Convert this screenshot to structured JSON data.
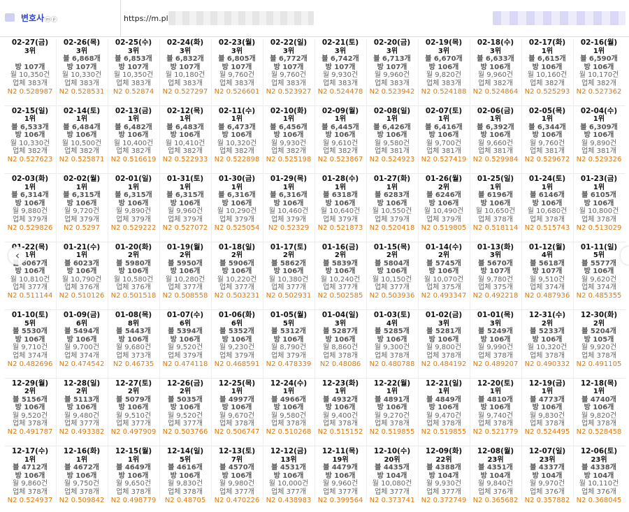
{
  "header": {
    "brand_label": "변호사",
    "url": "https://m.place"
  },
  "rows": [
    [
      {
        "date": "02-27(금)",
        "rank": "3위",
        "rev": "",
        "vis": "방 107개",
        "mon": "월 10,350건",
        "biz": "업체 383개",
        "n2": "N2 0.528987"
      },
      {
        "date": "02-26(목)",
        "rank": "3위",
        "rev": "블 6,868개",
        "vis": "방 107개",
        "mon": "월 10,330건",
        "biz": "업체 383개",
        "n2": "N2 0.528531"
      },
      {
        "date": "02-25(수)",
        "rank": "3위",
        "rev": "블 6,853개",
        "vis": "방 107개",
        "mon": "월 10,350건",
        "biz": "업체 383개",
        "n2": "N2 0.52874"
      },
      {
        "date": "02-24(화)",
        "rank": "3위",
        "rev": "블 6,832개",
        "vis": "방 107개",
        "mon": "월 10,180건",
        "biz": "업체 383개",
        "n2": "N2 0.527297"
      },
      {
        "date": "02-23(월)",
        "rank": "3위",
        "rev": "블 6,805개",
        "vis": "방 107개",
        "mon": "월 9,760건",
        "biz": "업체 383개",
        "n2": "N2 0.526601"
      },
      {
        "date": "02-22(일)",
        "rank": "3위",
        "rev": "블 6,772개",
        "vis": "방 107개",
        "mon": "월 9,760건",
        "biz": "업체 383개",
        "n2": "N2 0.523927"
      },
      {
        "date": "02-21(토)",
        "rank": "3위",
        "rev": "블 6,742개",
        "vis": "방 107개",
        "mon": "월 9,930건",
        "biz": "업체 383개",
        "n2": "N2 0.524478"
      },
      {
        "date": "02-20(금)",
        "rank": "3위",
        "rev": "블 6,713개",
        "vis": "방 107개",
        "mon": "월 9,960건",
        "biz": "업체 383개",
        "n2": "N2 0.523942"
      },
      {
        "date": "02-19(목)",
        "rank": "3위",
        "rev": "블 6,670개",
        "vis": "방 106개",
        "mon": "월 9,820건",
        "biz": "업체 383개",
        "n2": "N2 0.524188"
      },
      {
        "date": "02-18(수)",
        "rank": "3위",
        "rev": "블 6,633개",
        "vis": "방 106개",
        "mon": "월 9,960건",
        "biz": "업체 382개",
        "n2": "N2 0.524864"
      },
      {
        "date": "02-17(화)",
        "rank": "1위",
        "rev": "블 6,615개",
        "vis": "방 106개",
        "mon": "월 10,160건",
        "biz": "업체 382개",
        "n2": "N2 0.525293"
      },
      {
        "date": "02-16(월)",
        "rank": "1위",
        "rev": "블 6,590개",
        "vis": "방 106개",
        "mon": "월 10,170건",
        "biz": "업체 382개",
        "n2": "N2 0.527362"
      }
    ],
    [
      {
        "date": "02-15(일)",
        "rank": "1위",
        "rev": "블 6,533개",
        "vis": "방 106개",
        "mon": "월 10,330건",
        "biz": "업체 382개",
        "n2": "N2 0.527623"
      },
      {
        "date": "02-14(토)",
        "rank": "1위",
        "rev": "블 6,484개",
        "vis": "방 106개",
        "mon": "월 10,500건",
        "biz": "업체 382개",
        "n2": "N2 0.525871"
      },
      {
        "date": "02-13(금)",
        "rank": "1위",
        "rev": "블 6,482개",
        "vis": "방 106개",
        "mon": "월 10,400건",
        "biz": "업체 382개",
        "n2": "N2 0.516619"
      },
      {
        "date": "02-12(목)",
        "rank": "1위",
        "rev": "블 6,483개",
        "vis": "방 106개",
        "mon": "월 10,410건",
        "biz": "업체 382개",
        "n2": "N2 0.522933"
      },
      {
        "date": "02-11(수)",
        "rank": "1위",
        "rev": "블 6,473개",
        "vis": "방 106개",
        "mon": "월 10,320건",
        "biz": "업체 382개",
        "n2": "N2 0.522898"
      },
      {
        "date": "02-10(화)",
        "rank": "1위",
        "rev": "블 6,456개",
        "vis": "방 106개",
        "mon": "월 9,930건",
        "biz": "업체 382개",
        "n2": "N2 0.525198"
      },
      {
        "date": "02-09(월)",
        "rank": "1위",
        "rev": "블 6,445개",
        "vis": "방 106개",
        "mon": "월 9,610건",
        "biz": "업체 382개",
        "n2": "N2 0.523867"
      },
      {
        "date": "02-08(일)",
        "rank": "1위",
        "rev": "블 6,426개",
        "vis": "방 106개",
        "mon": "월 9,580건",
        "biz": "업체 381개",
        "n2": "N2 0.524923"
      },
      {
        "date": "02-07(토)",
        "rank": "1위",
        "rev": "블 6,416개",
        "vis": "방 106개",
        "mon": "월 9,700건",
        "biz": "업체 381개",
        "n2": "N2 0.527419"
      },
      {
        "date": "02-06(금)",
        "rank": "1위",
        "rev": "블 6,392개",
        "vis": "방 106개",
        "mon": "월 9,660건",
        "biz": "업체 381개",
        "n2": "N2 0.529984"
      },
      {
        "date": "02-05(목)",
        "rank": "1위",
        "rev": "블 6,344개",
        "vis": "방 106개",
        "mon": "월 9,760건",
        "biz": "업체 381개",
        "n2": "N2 0.529672"
      },
      {
        "date": "02-04(수)",
        "rank": "1위",
        "rev": "블 6,309개",
        "vis": "방 106개",
        "mon": "월 9,890건",
        "biz": "업체 381개",
        "n2": "N2 0.529326"
      }
    ],
    [
      {
        "date": "02-03(화)",
        "rank": "1위",
        "rev": "블 6,314개",
        "vis": "방 106개",
        "mon": "월 9,880건",
        "biz": "업체 379개",
        "n2": "N2 0.529826"
      },
      {
        "date": "02-02(월)",
        "rank": "1위",
        "rev": "블 6,315개",
        "vis": "방 106개",
        "mon": "월 9,720건",
        "biz": "업체 379개",
        "n2": "N2 0.5297"
      },
      {
        "date": "02-01(일)",
        "rank": "1위",
        "rev": "블 6,315개",
        "vis": "방 106개",
        "mon": "월 9,890건",
        "biz": "업체 379개",
        "n2": "N2 0.529222"
      },
      {
        "date": "01-31(토)",
        "rank": "1위",
        "rev": "블 6,315개",
        "vis": "방 106개",
        "mon": "월 9,960건",
        "biz": "업체 379개",
        "n2": "N2 0.527072"
      },
      {
        "date": "01-30(금)",
        "rank": "1위",
        "rev": "블 6,316개",
        "vis": "방 106개",
        "mon": "월 10,290건",
        "biz": "업체 379개",
        "n2": "N2 0.525054"
      },
      {
        "date": "01-29(목)",
        "rank": "1위",
        "rev": "블 6,316개",
        "vis": "방 106개",
        "mon": "월 10,460건",
        "biz": "업체 379개",
        "n2": "N2 0.52329"
      },
      {
        "date": "01-28(수)",
        "rank": "1위",
        "rev": "블 6318개",
        "vis": "방 106개",
        "mon": "월 10,640건",
        "biz": "업체 379개",
        "n2": "N2 0.521873"
      },
      {
        "date": "01-27(화)",
        "rank": "1위",
        "rev": "블 6283개",
        "vis": "방 106개",
        "mon": "월 10,550건",
        "biz": "업체 379개",
        "n2": "N2 0.520418"
      },
      {
        "date": "01-26(월)",
        "rank": "2위",
        "rev": "블 6246개",
        "vis": "방 106개",
        "mon": "월 10,490건",
        "biz": "업체 379개",
        "n2": "N2 0.519805"
      },
      {
        "date": "01-25(일)",
        "rank": "1위",
        "rev": "블 6196개",
        "vis": "방 106개",
        "mon": "월 10,650건",
        "biz": "업체 378개",
        "n2": "N2 0.518114"
      },
      {
        "date": "01-24(토)",
        "rank": "1위",
        "rev": "블 6146개",
        "vis": "방 106개",
        "mon": "월 10,680건",
        "biz": "업체 378개",
        "n2": "N2 0.515743"
      },
      {
        "date": "01-23(금)",
        "rank": "1위",
        "rev": "블 6105개",
        "vis": "방 106개",
        "mon": "월 10,800건",
        "biz": "업체 378개",
        "n2": "N2 0.513029"
      }
    ],
    [
      {
        "date": "01-22(목)",
        "rank": "1위",
        "rev": "블 6067개",
        "vis": "방 106개",
        "mon": "월 10,810건",
        "biz": "업체 377개",
        "n2": "N2 0.511144"
      },
      {
        "date": "01-21(수)",
        "rank": "1위",
        "rev": "블 6023개",
        "vis": "방 106개",
        "mon": "월 10,790건",
        "biz": "업체 376개",
        "n2": "N2 0.510126"
      },
      {
        "date": "01-20(화)",
        "rank": "2위",
        "rev": "블 5980개",
        "vis": "방 106개",
        "mon": "월 10,580건",
        "biz": "업체 376개",
        "n2": "N2 0.501518"
      },
      {
        "date": "01-19(월)",
        "rank": "2위",
        "rev": "블 5950개",
        "vis": "방 106개",
        "mon": "월 10,280건",
        "biz": "업체 377개",
        "n2": "N2 0.508558"
      },
      {
        "date": "01-18(일)",
        "rank": "2위",
        "rev": "블 5906개",
        "vis": "방 106개",
        "mon": "월 10,220건",
        "biz": "업체 377개",
        "n2": "N2 0.503231"
      },
      {
        "date": "01-17(토)",
        "rank": "2위",
        "rev": "블 5862개",
        "vis": "방 106개",
        "mon": "월 10,380건",
        "biz": "업체 377개",
        "n2": "N2 0.502931"
      },
      {
        "date": "01-16(금)",
        "rank": "2위",
        "rev": "블 5839개",
        "vis": "방 106개",
        "mon": "월 10,240건",
        "biz": "업체 377개",
        "n2": "N2 0.502585"
      },
      {
        "date": "01-15(목)",
        "rank": "2위",
        "rev": "블 5804개",
        "vis": "방 106개",
        "mon": "월 10,150건",
        "biz": "업체 377개",
        "n2": "N2 0.503936"
      },
      {
        "date": "01-14(수)",
        "rank": "2위",
        "rev": "블 5745개",
        "vis": "방 106개",
        "mon": "월 10,070건",
        "biz": "업체 375개",
        "n2": "N2 0.493347"
      },
      {
        "date": "01-13(화)",
        "rank": "3위",
        "rev": "블 5670개",
        "vis": "방 107개",
        "mon": "월 9,780건",
        "biz": "업체 375개",
        "n2": "N2 0.492218"
      },
      {
        "date": "01-12(월)",
        "rank": "4위",
        "rev": "블 5618개",
        "vis": "방 107개",
        "mon": "월 9,510건",
        "biz": "업체 374개",
        "n2": "N2 0.487936"
      },
      {
        "date": "01-11(일)",
        "rank": "5위",
        "rev": "블 5577개",
        "vis": "방 106개",
        "mon": "월 9,620건",
        "biz": "업체 374개",
        "n2": "N2 0.485355"
      }
    ],
    [
      {
        "date": "01-10(토)",
        "rank": "5위",
        "rev": "블 5530개",
        "vis": "방 106개",
        "mon": "월 9,710건",
        "biz": "업체 374개",
        "n2": "N2 0.482696"
      },
      {
        "date": "01-09(금)",
        "rank": "6위",
        "rev": "블 5494개",
        "vis": "방 106개",
        "mon": "월 9,700건",
        "biz": "업체 374개",
        "n2": "N2 0.474542"
      },
      {
        "date": "01-08(목)",
        "rank": "8위",
        "rev": "블 5443개",
        "vis": "방 106개",
        "mon": "월 9,680건",
        "biz": "업체 373개",
        "n2": "N2 0.46735"
      },
      {
        "date": "01-07(수)",
        "rank": "6위",
        "rev": "블 5394개",
        "vis": "방 106개",
        "mon": "월 9,520건",
        "biz": "업체 379개",
        "n2": "N2 0.474118"
      },
      {
        "date": "01-06(화)",
        "rank": "6위",
        "rev": "블 5352개",
        "vis": "방 106개",
        "mon": "월 9,230건",
        "biz": "업체 379개",
        "n2": "N2 0.468591"
      },
      {
        "date": "01-05(월)",
        "rank": "5위",
        "rev": "블 5312개",
        "vis": "방 106개",
        "mon": "월 8,790건",
        "biz": "업체 379개",
        "n2": "N2 0.478339"
      },
      {
        "date": "01-04(일)",
        "rank": "3위",
        "rev": "블 5287개",
        "vis": "방 106개",
        "mon": "월 8,860건",
        "biz": "업체 378개",
        "n2": "N2 0.48086"
      },
      {
        "date": "01-03(토)",
        "rank": "4위",
        "rev": "블 5285개",
        "vis": "방 106개",
        "mon": "월 9,300건",
        "biz": "업체 378개",
        "n2": "N2 0.480788"
      },
      {
        "date": "01-02(금)",
        "rank": "3위",
        "rev": "블 5281개",
        "vis": "방 106개",
        "mon": "월 9,800건",
        "biz": "업체 378개",
        "n2": "N2 0.484192"
      },
      {
        "date": "01-01(목)",
        "rank": "3위",
        "rev": "블 5249개",
        "vis": "방 106개",
        "mon": "월 9,990건",
        "biz": "업체 378개",
        "n2": "N2 0.489207"
      },
      {
        "date": "12-31(수)",
        "rank": "2위",
        "rev": "블 5233개",
        "vis": "방 106개",
        "mon": "월 10,320건",
        "biz": "업체 378개",
        "n2": "N2 0.490332"
      },
      {
        "date": "12-30(화)",
        "rank": "2위",
        "rev": "블 5204개",
        "vis": "방 105개",
        "mon": "월 9,920건",
        "biz": "업체 378개",
        "n2": "N2 0.491105"
      }
    ],
    [
      {
        "date": "12-29(월)",
        "rank": "2위",
        "rev": "블 5156개",
        "vis": "방 106개",
        "mon": "월 9,520건",
        "biz": "업체 378개",
        "n2": "N2 0.491787"
      },
      {
        "date": "12-28(일)",
        "rank": "2위",
        "rev": "블 5113개",
        "vis": "방 106개",
        "mon": "월 9,480건",
        "biz": "업체 377개",
        "n2": "N2 0.493382"
      },
      {
        "date": "12-27(토)",
        "rank": "2위",
        "rev": "블 5079개",
        "vis": "방 106개",
        "mon": "월 9,510건",
        "biz": "업체 377개",
        "n2": "N2 0.497909"
      },
      {
        "date": "12-26(금)",
        "rank": "2위",
        "rev": "블 5035개",
        "vis": "방 106개",
        "mon": "월 9,520건",
        "biz": "업체 377개",
        "n2": "N2 0.503766"
      },
      {
        "date": "12-25(목)",
        "rank": "1위",
        "rev": "블 4997개",
        "vis": "방 106개",
        "mon": "월 9,670건",
        "biz": "업체 378개",
        "n2": "N2 0.506747"
      },
      {
        "date": "12-24(수)",
        "rank": "1위",
        "rev": "블 4966개",
        "vis": "방 106개",
        "mon": "월 9,580건",
        "biz": "업체 378개",
        "n2": "N2 0.510268"
      },
      {
        "date": "12-23(화)",
        "rank": "1위",
        "rev": "블 4932개",
        "vis": "방 106개",
        "mon": "월 9,400건",
        "biz": "업체 378개",
        "n2": "N2 0.515152"
      },
      {
        "date": "12-22(월)",
        "rank": "1위",
        "rev": "블 4891개",
        "vis": "방 106개",
        "mon": "월 9,270건",
        "biz": "업체 378개",
        "n2": "N2 0.519855"
      },
      {
        "date": "12-21(일)",
        "rank": "1위",
        "rev": "블 4849개",
        "vis": "방 106개",
        "mon": "월 9,470건",
        "biz": "업체 378개",
        "n2": "N2 0.519855"
      },
      {
        "date": "12-20(토)",
        "rank": "1위",
        "rev": "블 4810개",
        "vis": "방 106개",
        "mon": "월 9,740건",
        "biz": "업체 378개",
        "n2": "N2 0.521779"
      },
      {
        "date": "12-19(금)",
        "rank": "1위",
        "rev": "블 4773개",
        "vis": "방 106개",
        "mon": "월 9,830건",
        "biz": "업체 378개",
        "n2": "N2 0.524495"
      },
      {
        "date": "12-18(목)",
        "rank": "1위",
        "rev": "블 4740개",
        "vis": "방 106개",
        "mon": "월 9,820건",
        "biz": "업체 378개",
        "n2": "N2 0.528458"
      }
    ],
    [
      {
        "date": "12-17(수)",
        "rank": "1위",
        "rev": "블 4712개",
        "vis": "방 106개",
        "mon": "월 9,860건",
        "biz": "업체 378개",
        "n2": "N2 0.524937"
      },
      {
        "date": "12-16(화)",
        "rank": "1위",
        "rev": "블 4672개",
        "vis": "방 106개",
        "mon": "월 9,750건",
        "biz": "업체 378개",
        "n2": "N2 0.509842"
      },
      {
        "date": "12-15(월)",
        "rank": "1위",
        "rev": "블 4649개",
        "vis": "방 106개",
        "mon": "월 9,650건",
        "biz": "업체 378개",
        "n2": "N2 0.498779"
      },
      {
        "date": "12-14(일)",
        "rank": "5위",
        "rev": "블 4616개",
        "vis": "방 106개",
        "mon": "월 9,830건",
        "biz": "업체 378개",
        "n2": "N2 0.48705"
      },
      {
        "date": "12-13(토)",
        "rank": "7위",
        "rev": "블 4570개",
        "vis": "방 106개",
        "mon": "월 9,980건",
        "biz": "업체 377개",
        "n2": "N2 0.470226"
      },
      {
        "date": "12-12(금)",
        "rank": "13위",
        "rev": "블 4531개",
        "vis": "방 106개",
        "mon": "월 10,000건",
        "biz": "업체 377개",
        "n2": "N2 0.438983"
      },
      {
        "date": "12-11(목)",
        "rank": "19위",
        "rev": "블 4479개",
        "vis": "방 106개",
        "mon": "월 9,960건",
        "biz": "업체 377개",
        "n2": "N2 0.399564"
      },
      {
        "date": "12-10(수)",
        "rank": "20위",
        "rev": "블 4435개",
        "vis": "방 104개",
        "mon": "월 10,080건",
        "biz": "업체 377개",
        "n2": "N2 0.373741"
      },
      {
        "date": "12-09(화)",
        "rank": "22위",
        "rev": "블 4388개",
        "vis": "방 104개",
        "mon": "월 9,930건",
        "biz": "업체 377개",
        "n2": "N2 0.372749"
      },
      {
        "date": "12-08(월)",
        "rank": "23위",
        "rev": "블 4351개",
        "vis": "방 104개",
        "mon": "월 9,840건",
        "biz": "업체 376개",
        "n2": "N2 0.365682"
      },
      {
        "date": "12-07(일)",
        "rank": "23위",
        "rev": "블 4337개",
        "vis": "방 104개",
        "mon": "월 9,970건",
        "biz": "업체 376개",
        "n2": "N2 0.357882"
      },
      {
        "date": "12-06(토)",
        "rank": "23위",
        "rev": "블 4338개",
        "vis": "방 104개",
        "mon": "월 10,110건",
        "biz": "업체 376개",
        "n2": "N2 0.368045"
      }
    ]
  ]
}
